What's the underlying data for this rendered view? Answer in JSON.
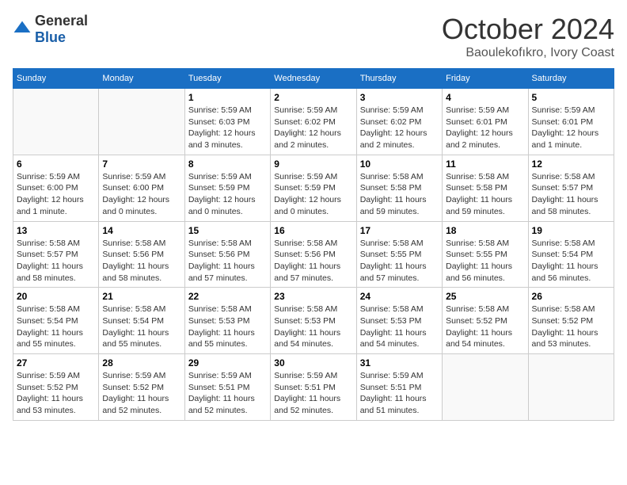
{
  "header": {
    "logo_general": "General",
    "logo_blue": "Blue",
    "month_title": "October 2024",
    "location": "Baoulekofıkro, Ivory Coast"
  },
  "weekdays": [
    "Sunday",
    "Monday",
    "Tuesday",
    "Wednesday",
    "Thursday",
    "Friday",
    "Saturday"
  ],
  "weeks": [
    [
      {
        "day": "",
        "info": ""
      },
      {
        "day": "",
        "info": ""
      },
      {
        "day": "1",
        "info": "Sunrise: 5:59 AM\nSunset: 6:03 PM\nDaylight: 12 hours and 3 minutes."
      },
      {
        "day": "2",
        "info": "Sunrise: 5:59 AM\nSunset: 6:02 PM\nDaylight: 12 hours and 2 minutes."
      },
      {
        "day": "3",
        "info": "Sunrise: 5:59 AM\nSunset: 6:02 PM\nDaylight: 12 hours and 2 minutes."
      },
      {
        "day": "4",
        "info": "Sunrise: 5:59 AM\nSunset: 6:01 PM\nDaylight: 12 hours and 2 minutes."
      },
      {
        "day": "5",
        "info": "Sunrise: 5:59 AM\nSunset: 6:01 PM\nDaylight: 12 hours and 1 minute."
      }
    ],
    [
      {
        "day": "6",
        "info": "Sunrise: 5:59 AM\nSunset: 6:00 PM\nDaylight: 12 hours and 1 minute."
      },
      {
        "day": "7",
        "info": "Sunrise: 5:59 AM\nSunset: 6:00 PM\nDaylight: 12 hours and 0 minutes."
      },
      {
        "day": "8",
        "info": "Sunrise: 5:59 AM\nSunset: 5:59 PM\nDaylight: 12 hours and 0 minutes."
      },
      {
        "day": "9",
        "info": "Sunrise: 5:59 AM\nSunset: 5:59 PM\nDaylight: 12 hours and 0 minutes."
      },
      {
        "day": "10",
        "info": "Sunrise: 5:58 AM\nSunset: 5:58 PM\nDaylight: 11 hours and 59 minutes."
      },
      {
        "day": "11",
        "info": "Sunrise: 5:58 AM\nSunset: 5:58 PM\nDaylight: 11 hours and 59 minutes."
      },
      {
        "day": "12",
        "info": "Sunrise: 5:58 AM\nSunset: 5:57 PM\nDaylight: 11 hours and 58 minutes."
      }
    ],
    [
      {
        "day": "13",
        "info": "Sunrise: 5:58 AM\nSunset: 5:57 PM\nDaylight: 11 hours and 58 minutes."
      },
      {
        "day": "14",
        "info": "Sunrise: 5:58 AM\nSunset: 5:56 PM\nDaylight: 11 hours and 58 minutes."
      },
      {
        "day": "15",
        "info": "Sunrise: 5:58 AM\nSunset: 5:56 PM\nDaylight: 11 hours and 57 minutes."
      },
      {
        "day": "16",
        "info": "Sunrise: 5:58 AM\nSunset: 5:56 PM\nDaylight: 11 hours and 57 minutes."
      },
      {
        "day": "17",
        "info": "Sunrise: 5:58 AM\nSunset: 5:55 PM\nDaylight: 11 hours and 57 minutes."
      },
      {
        "day": "18",
        "info": "Sunrise: 5:58 AM\nSunset: 5:55 PM\nDaylight: 11 hours and 56 minutes."
      },
      {
        "day": "19",
        "info": "Sunrise: 5:58 AM\nSunset: 5:54 PM\nDaylight: 11 hours and 56 minutes."
      }
    ],
    [
      {
        "day": "20",
        "info": "Sunrise: 5:58 AM\nSunset: 5:54 PM\nDaylight: 11 hours and 55 minutes."
      },
      {
        "day": "21",
        "info": "Sunrise: 5:58 AM\nSunset: 5:54 PM\nDaylight: 11 hours and 55 minutes."
      },
      {
        "day": "22",
        "info": "Sunrise: 5:58 AM\nSunset: 5:53 PM\nDaylight: 11 hours and 55 minutes."
      },
      {
        "day": "23",
        "info": "Sunrise: 5:58 AM\nSunset: 5:53 PM\nDaylight: 11 hours and 54 minutes."
      },
      {
        "day": "24",
        "info": "Sunrise: 5:58 AM\nSunset: 5:53 PM\nDaylight: 11 hours and 54 minutes."
      },
      {
        "day": "25",
        "info": "Sunrise: 5:58 AM\nSunset: 5:52 PM\nDaylight: 11 hours and 54 minutes."
      },
      {
        "day": "26",
        "info": "Sunrise: 5:58 AM\nSunset: 5:52 PM\nDaylight: 11 hours and 53 minutes."
      }
    ],
    [
      {
        "day": "27",
        "info": "Sunrise: 5:59 AM\nSunset: 5:52 PM\nDaylight: 11 hours and 53 minutes."
      },
      {
        "day": "28",
        "info": "Sunrise: 5:59 AM\nSunset: 5:52 PM\nDaylight: 11 hours and 52 minutes."
      },
      {
        "day": "29",
        "info": "Sunrise: 5:59 AM\nSunset: 5:51 PM\nDaylight: 11 hours and 52 minutes."
      },
      {
        "day": "30",
        "info": "Sunrise: 5:59 AM\nSunset: 5:51 PM\nDaylight: 11 hours and 52 minutes."
      },
      {
        "day": "31",
        "info": "Sunrise: 5:59 AM\nSunset: 5:51 PM\nDaylight: 11 hours and 51 minutes."
      },
      {
        "day": "",
        "info": ""
      },
      {
        "day": "",
        "info": ""
      }
    ]
  ]
}
